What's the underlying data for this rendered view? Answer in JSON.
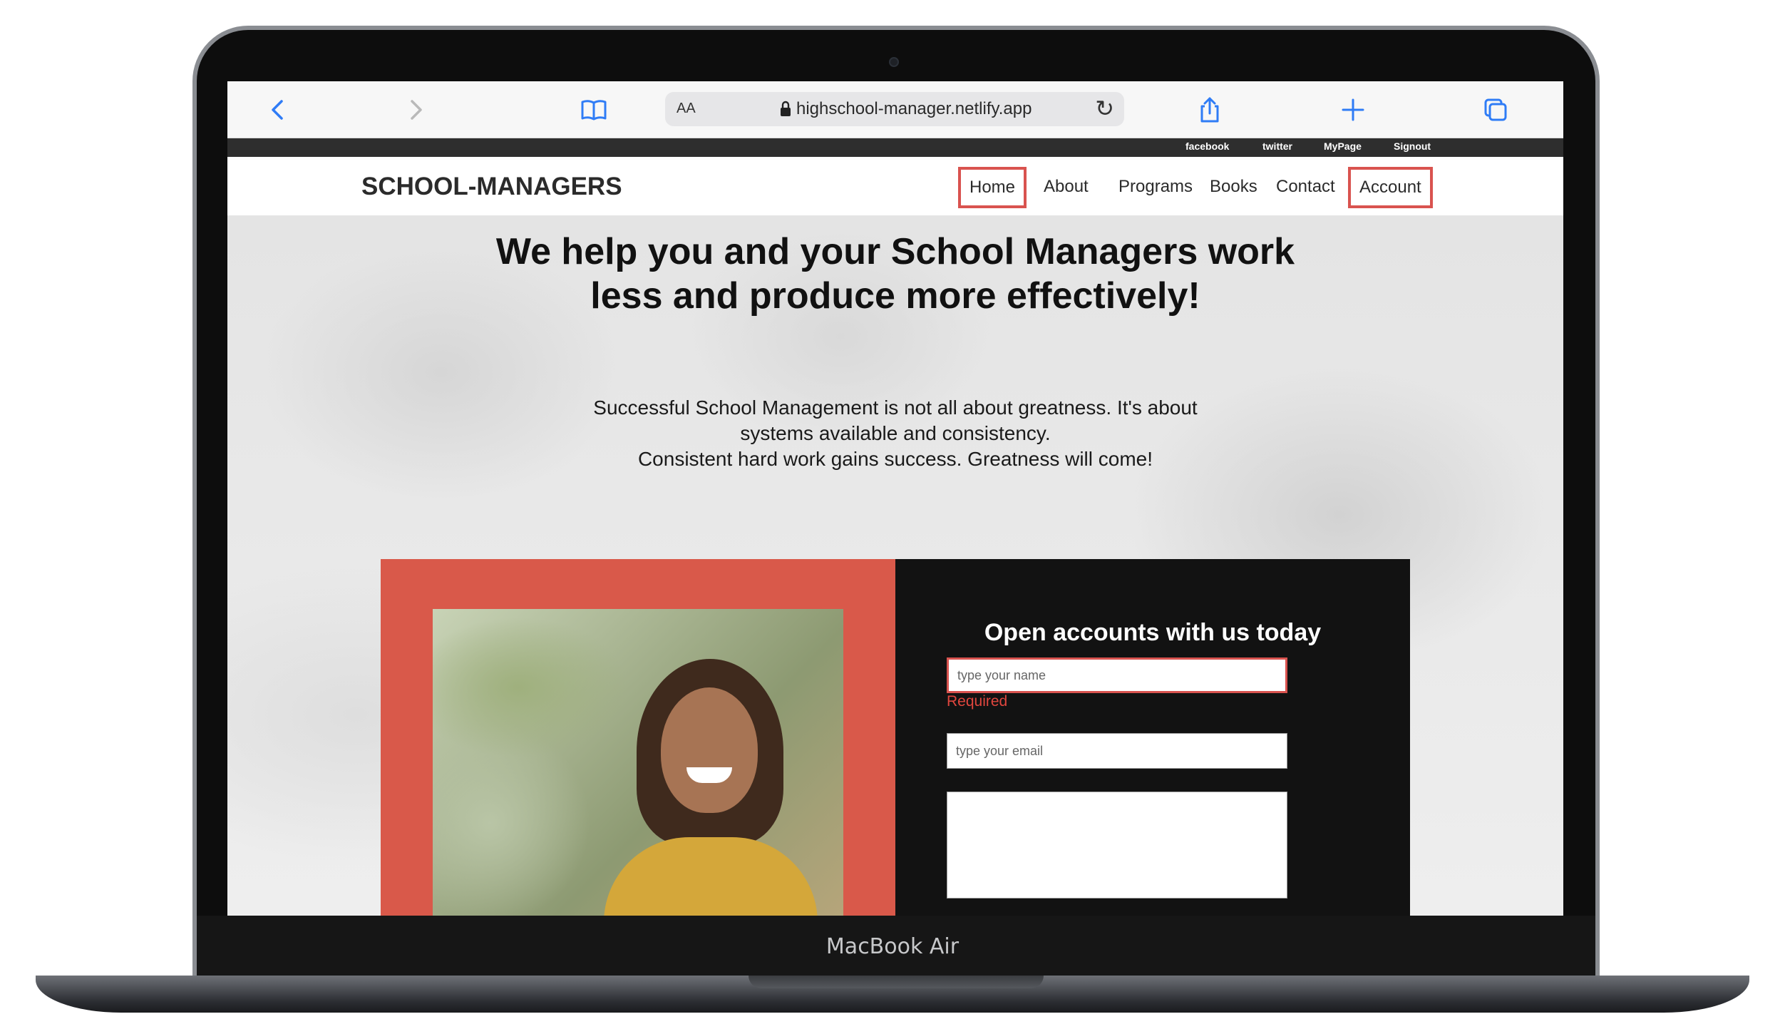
{
  "browser": {
    "url": "highschool-manager.netlify.app",
    "text_size_label": "AA"
  },
  "social_links": [
    "facebook",
    "twitter",
    "MyPage",
    "Signout"
  ],
  "site": {
    "brand": "SCHOOL-MANAGERS",
    "nav": [
      "Home",
      "About",
      "Programs",
      "Books",
      "Contact",
      "Account"
    ]
  },
  "hero": {
    "title_line1": "We help you and your School Managers work",
    "title_line2": "less and produce more effectively!",
    "sub_line1": "Successful School Management is not all about greatness. It's about",
    "sub_line2": "systems available and consistency.",
    "sub_line3": "Consistent hard work gains success. Greatness will come!"
  },
  "signup": {
    "title": "Open accounts with us today",
    "name_placeholder": "type your name",
    "name_error": "Required",
    "email_placeholder": "type your email",
    "message_placeholder": ""
  },
  "device_label": "MacBook Air"
}
